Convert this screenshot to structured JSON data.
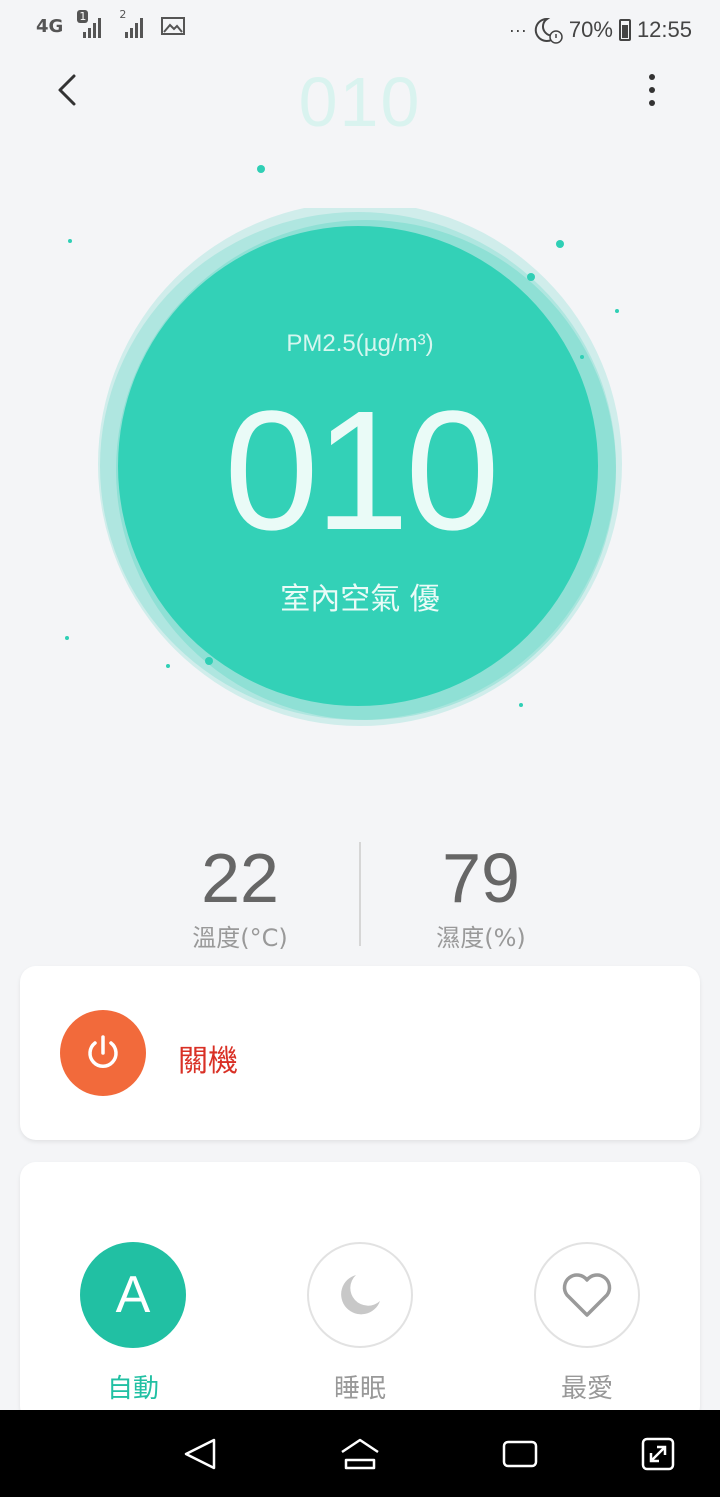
{
  "status_bar": {
    "network": "4G",
    "sim1": "1",
    "sim2": "2",
    "dots": "···",
    "battery": "70%",
    "time": "12:55"
  },
  "header": {
    "title": "010"
  },
  "gauge": {
    "label": "PM2.5(µg/m³)",
    "value": "010",
    "status": "室內空氣 優",
    "color": "#2fcfb5"
  },
  "stats": {
    "temperature": {
      "value": "22",
      "label": "溫度(°C)"
    },
    "humidity": {
      "value": "79",
      "label": "濕度(%)"
    }
  },
  "power": {
    "label": "關機",
    "button_color": "#f26a3b"
  },
  "modes": [
    {
      "icon_letter": "A",
      "label": "自動",
      "active": true
    },
    {
      "icon": "moon-icon",
      "label": "睡眠",
      "active": false
    },
    {
      "icon": "heart-icon",
      "label": "最愛",
      "active": false
    }
  ],
  "colors": {
    "accent": "#21c0a3",
    "power": "#f26a3b",
    "power_text": "#d93025"
  }
}
